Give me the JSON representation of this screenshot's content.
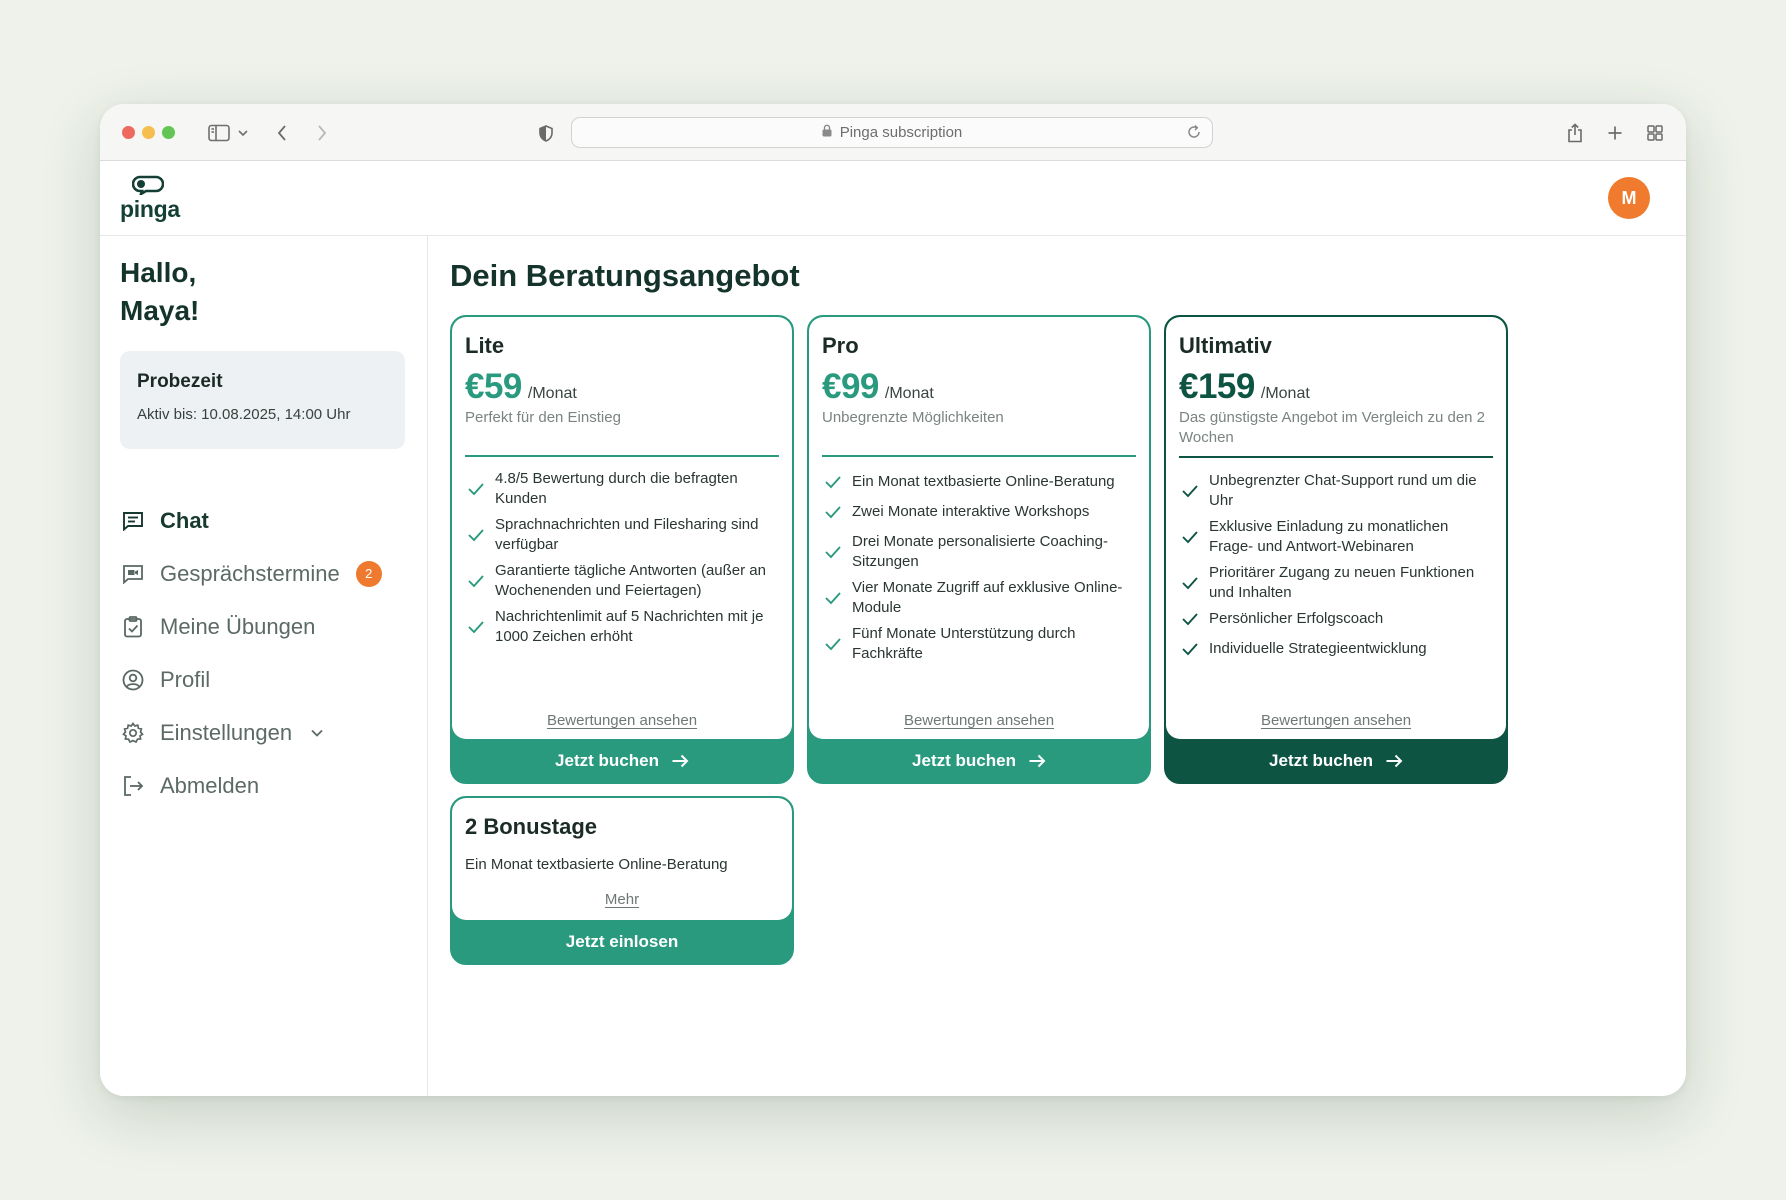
{
  "browser": {
    "url_text": "Pinga subscription"
  },
  "app": {
    "logo_text": "pinga",
    "avatar_initial": "M"
  },
  "sidebar": {
    "greeting_line1": "Hallo,",
    "greeting_line2": "Maya!",
    "trial": {
      "title": "Probezeit",
      "subtitle": "Aktiv bis: 10.08.2025, 14:00 Uhr"
    },
    "nav": [
      {
        "label": "Chat",
        "icon": "chat-icon",
        "active": true
      },
      {
        "label": "Gesprächstermine",
        "icon": "video-call-icon",
        "badge": "2"
      },
      {
        "label": "Meine Übungen",
        "icon": "clipboard-check-icon"
      },
      {
        "label": "Profil",
        "icon": "user-circle-icon"
      },
      {
        "label": "Einstellungen",
        "icon": "gear-icon",
        "has_chevron": true
      },
      {
        "label": "Abmelden",
        "icon": "logout-icon"
      }
    ]
  },
  "main": {
    "title": "Dein Beratungsangebot",
    "plans": [
      {
        "name": "Lite",
        "price": "€59",
        "period": "/Monat",
        "tagline": "Perfekt für den Einstieg",
        "features": [
          "4.8/5 Bewertung durch die befragten Kunden",
          "Sprachnachrichten und Filesharing sind verfügbar",
          "Garantierte tägliche Antworten (außer an Wochenenden und Feiertagen)",
          "Nachrichtenlimit auf 5 Nachrichten mit je 1000 Zeichen erhöht"
        ],
        "reviews_link": "Bewertungen ansehen",
        "cta": "Jetzt buchen"
      },
      {
        "name": "Pro",
        "price": "€99",
        "period": "/Monat",
        "tagline": "Unbegrenzte Möglichkeiten",
        "features": [
          "Ein Monat textbasierte Online-Beratung",
          "Zwei Monate interaktive Workshops",
          "Drei Monate personalisierte Coaching-Sitzungen",
          "Vier Monate Zugriff auf exklusive Online-Module",
          "Fünf Monate Unterstützung durch Fachkräfte"
        ],
        "reviews_link": "Bewertungen ansehen",
        "cta": "Jetzt buchen"
      },
      {
        "name": "Ultimativ",
        "price": "€159",
        "period": "/Monat",
        "tagline": "Das günstigste Angebot im Vergleich zu den 2 Wochen",
        "features": [
          "Unbegrenzter Chat-Support rund um die Uhr",
          "Exklusive Einladung zu monatlichen Frage- und Antwort-Webinaren",
          "Prioritärer Zugang zu neuen Funktionen und Inhalten",
          "Persönlicher Erfolgscoach",
          "Individuelle Strategieentwicklung"
        ],
        "reviews_link": "Bewertungen ansehen",
        "cta": "Jetzt buchen"
      }
    ],
    "bonus": {
      "name": "2 Bonustage",
      "subtitle": "Ein Monat textbasierte Online-Beratung",
      "more_link": "Mehr",
      "cta": "Jetzt einlosen"
    }
  },
  "colors": {
    "accent": "#2a9a7f",
    "accent_dark": "#0d5443",
    "avatar": "#f07a2e",
    "badge": "#ef7a2f"
  }
}
